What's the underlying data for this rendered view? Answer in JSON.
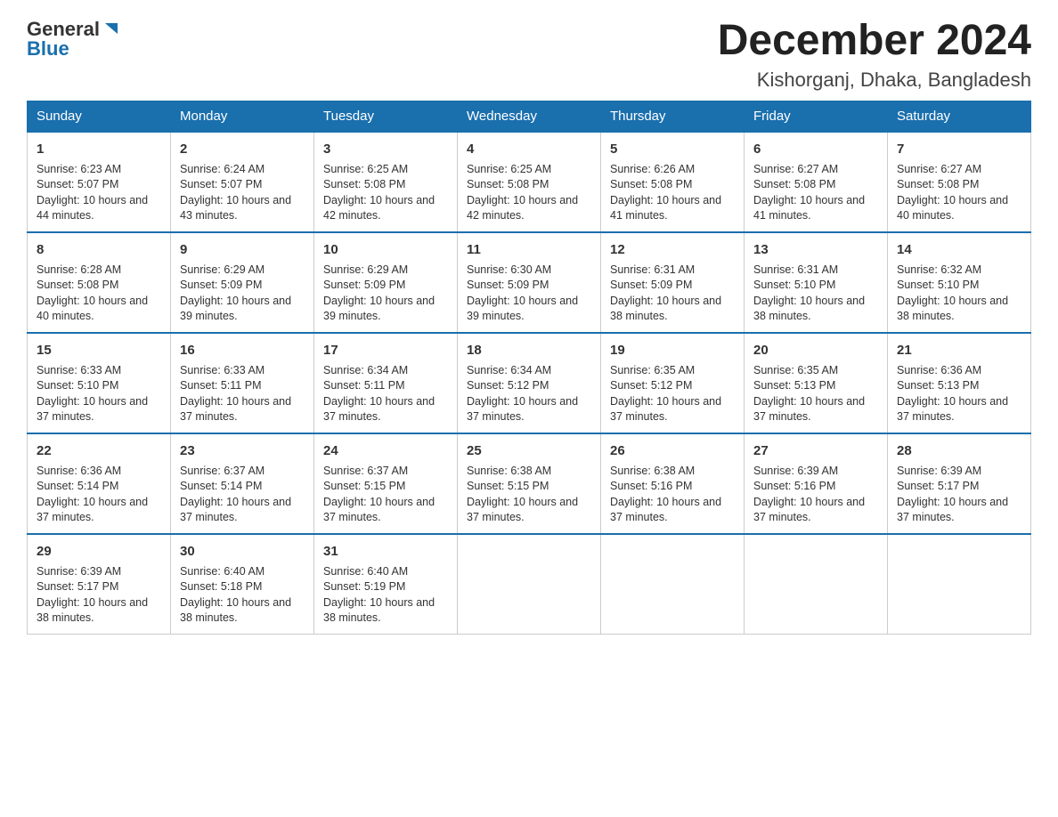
{
  "header": {
    "logo_general": "General",
    "logo_blue": "Blue",
    "month_title": "December 2024",
    "location": "Kishorganj, Dhaka, Bangladesh"
  },
  "weekdays": [
    "Sunday",
    "Monday",
    "Tuesday",
    "Wednesday",
    "Thursday",
    "Friday",
    "Saturday"
  ],
  "weeks": [
    [
      {
        "day": 1,
        "sunrise": "6:23 AM",
        "sunset": "5:07 PM",
        "daylight": "10 hours and 44 minutes."
      },
      {
        "day": 2,
        "sunrise": "6:24 AM",
        "sunset": "5:07 PM",
        "daylight": "10 hours and 43 minutes."
      },
      {
        "day": 3,
        "sunrise": "6:25 AM",
        "sunset": "5:08 PM",
        "daylight": "10 hours and 42 minutes."
      },
      {
        "day": 4,
        "sunrise": "6:25 AM",
        "sunset": "5:08 PM",
        "daylight": "10 hours and 42 minutes."
      },
      {
        "day": 5,
        "sunrise": "6:26 AM",
        "sunset": "5:08 PM",
        "daylight": "10 hours and 41 minutes."
      },
      {
        "day": 6,
        "sunrise": "6:27 AM",
        "sunset": "5:08 PM",
        "daylight": "10 hours and 41 minutes."
      },
      {
        "day": 7,
        "sunrise": "6:27 AM",
        "sunset": "5:08 PM",
        "daylight": "10 hours and 40 minutes."
      }
    ],
    [
      {
        "day": 8,
        "sunrise": "6:28 AM",
        "sunset": "5:08 PM",
        "daylight": "10 hours and 40 minutes."
      },
      {
        "day": 9,
        "sunrise": "6:29 AM",
        "sunset": "5:09 PM",
        "daylight": "10 hours and 39 minutes."
      },
      {
        "day": 10,
        "sunrise": "6:29 AM",
        "sunset": "5:09 PM",
        "daylight": "10 hours and 39 minutes."
      },
      {
        "day": 11,
        "sunrise": "6:30 AM",
        "sunset": "5:09 PM",
        "daylight": "10 hours and 39 minutes."
      },
      {
        "day": 12,
        "sunrise": "6:31 AM",
        "sunset": "5:09 PM",
        "daylight": "10 hours and 38 minutes."
      },
      {
        "day": 13,
        "sunrise": "6:31 AM",
        "sunset": "5:10 PM",
        "daylight": "10 hours and 38 minutes."
      },
      {
        "day": 14,
        "sunrise": "6:32 AM",
        "sunset": "5:10 PM",
        "daylight": "10 hours and 38 minutes."
      }
    ],
    [
      {
        "day": 15,
        "sunrise": "6:33 AM",
        "sunset": "5:10 PM",
        "daylight": "10 hours and 37 minutes."
      },
      {
        "day": 16,
        "sunrise": "6:33 AM",
        "sunset": "5:11 PM",
        "daylight": "10 hours and 37 minutes."
      },
      {
        "day": 17,
        "sunrise": "6:34 AM",
        "sunset": "5:11 PM",
        "daylight": "10 hours and 37 minutes."
      },
      {
        "day": 18,
        "sunrise": "6:34 AM",
        "sunset": "5:12 PM",
        "daylight": "10 hours and 37 minutes."
      },
      {
        "day": 19,
        "sunrise": "6:35 AM",
        "sunset": "5:12 PM",
        "daylight": "10 hours and 37 minutes."
      },
      {
        "day": 20,
        "sunrise": "6:35 AM",
        "sunset": "5:13 PM",
        "daylight": "10 hours and 37 minutes."
      },
      {
        "day": 21,
        "sunrise": "6:36 AM",
        "sunset": "5:13 PM",
        "daylight": "10 hours and 37 minutes."
      }
    ],
    [
      {
        "day": 22,
        "sunrise": "6:36 AM",
        "sunset": "5:14 PM",
        "daylight": "10 hours and 37 minutes."
      },
      {
        "day": 23,
        "sunrise": "6:37 AM",
        "sunset": "5:14 PM",
        "daylight": "10 hours and 37 minutes."
      },
      {
        "day": 24,
        "sunrise": "6:37 AM",
        "sunset": "5:15 PM",
        "daylight": "10 hours and 37 minutes."
      },
      {
        "day": 25,
        "sunrise": "6:38 AM",
        "sunset": "5:15 PM",
        "daylight": "10 hours and 37 minutes."
      },
      {
        "day": 26,
        "sunrise": "6:38 AM",
        "sunset": "5:16 PM",
        "daylight": "10 hours and 37 minutes."
      },
      {
        "day": 27,
        "sunrise": "6:39 AM",
        "sunset": "5:16 PM",
        "daylight": "10 hours and 37 minutes."
      },
      {
        "day": 28,
        "sunrise": "6:39 AM",
        "sunset": "5:17 PM",
        "daylight": "10 hours and 37 minutes."
      }
    ],
    [
      {
        "day": 29,
        "sunrise": "6:39 AM",
        "sunset": "5:17 PM",
        "daylight": "10 hours and 38 minutes."
      },
      {
        "day": 30,
        "sunrise": "6:40 AM",
        "sunset": "5:18 PM",
        "daylight": "10 hours and 38 minutes."
      },
      {
        "day": 31,
        "sunrise": "6:40 AM",
        "sunset": "5:19 PM",
        "daylight": "10 hours and 38 minutes."
      },
      null,
      null,
      null,
      null
    ]
  ]
}
